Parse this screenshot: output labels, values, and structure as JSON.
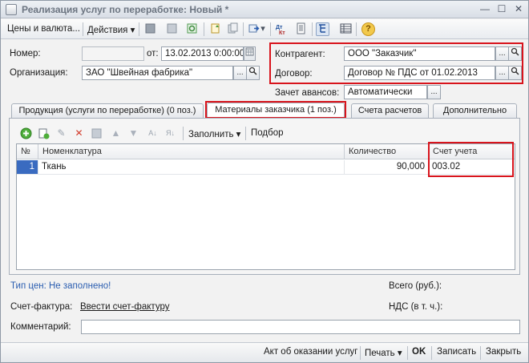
{
  "window": {
    "title": "Реализация услуг по переработке: Новый *",
    "minimize": "—",
    "maximize": "☐",
    "close": "✕"
  },
  "toolbar": {
    "prices_label": "Цены и валюта...",
    "actions_label": "Действия",
    "dropdown_arrow": "▾"
  },
  "form": {
    "number_label": "Номер:",
    "number_value": "",
    "date_label": "от:",
    "date_value": "13.02.2013  0:00:00",
    "org_label": "Организация:",
    "org_value": "ЗАО \"Швейная фабрика\"",
    "counterparty_label": "Контрагент:",
    "counterparty_value": "ООО \"Заказчик\"",
    "contract_label": "Договор:",
    "contract_value": "Договор № ПДС от 01.02.2013",
    "advance_label": "Зачет авансов:",
    "advance_value": "Автоматически",
    "ellipsis": "...",
    "search_glyph": "⚲"
  },
  "tabs": [
    {
      "label": "Продукция (услуги по переработке) (0 поз.)"
    },
    {
      "label": "Материалы заказчика (1 поз.)"
    },
    {
      "label": "Счета расчетов"
    },
    {
      "label": "Дополнительно"
    }
  ],
  "subtoolbar": {
    "fill_label": "Заполнить",
    "select_label": "Подбор"
  },
  "table": {
    "columns": [
      "№",
      "Номенклатура",
      "Количество",
      "Счет учета"
    ],
    "rows": [
      {
        "num": "1",
        "item": "Ткань",
        "qty": "90,000",
        "account": "003.02"
      }
    ]
  },
  "footer": {
    "price_type_text": "Тип цен: Не заполнено!",
    "total_label": "Всего (руб.):",
    "total_value": "",
    "invoice_label": "Счет-фактура:",
    "invoice_link": "Ввести счет-фактуру",
    "vat_label": "НДС (в т. ч.):",
    "vat_value": "",
    "comment_label": "Комментарий:",
    "comment_value": ""
  },
  "bottombar": {
    "act_label": "Акт об оказании услуг",
    "print_label": "Печать",
    "ok_label": "OK",
    "save_label": "Записать",
    "close_label": "Закрыть"
  },
  "colors": {
    "highlight": "#d8141c",
    "link_blue": "#2a5db0"
  }
}
